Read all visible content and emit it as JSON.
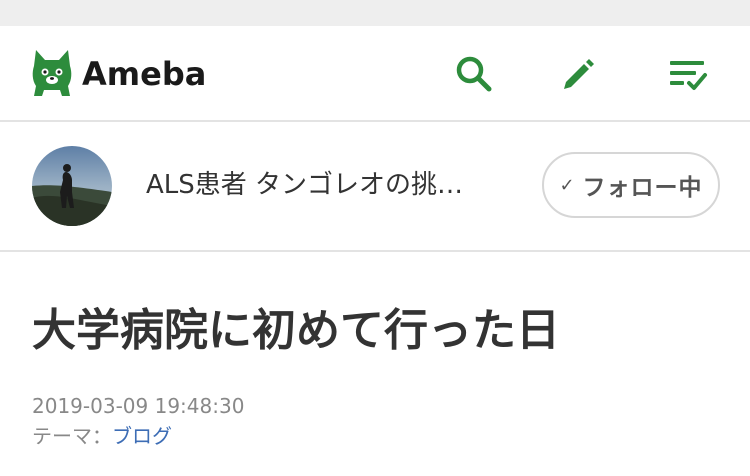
{
  "colors": {
    "brand_green": "#2d8c3c",
    "link_blue": "#3d6db5",
    "text_main": "#333333",
    "text_muted": "#888888"
  },
  "header": {
    "logo_text": "Ameba",
    "icons": [
      "search-icon",
      "pencil-icon",
      "reader-list-icon"
    ]
  },
  "blog": {
    "title": "ALS患者 タンゴレオの挑…",
    "follow_label": "フォロー中",
    "follow_check": "✓"
  },
  "article": {
    "title": "大学病院に初めて行った日",
    "date": "2019-03-09 19:48:30",
    "theme_label": "テーマ：",
    "theme_value": "ブログ"
  }
}
